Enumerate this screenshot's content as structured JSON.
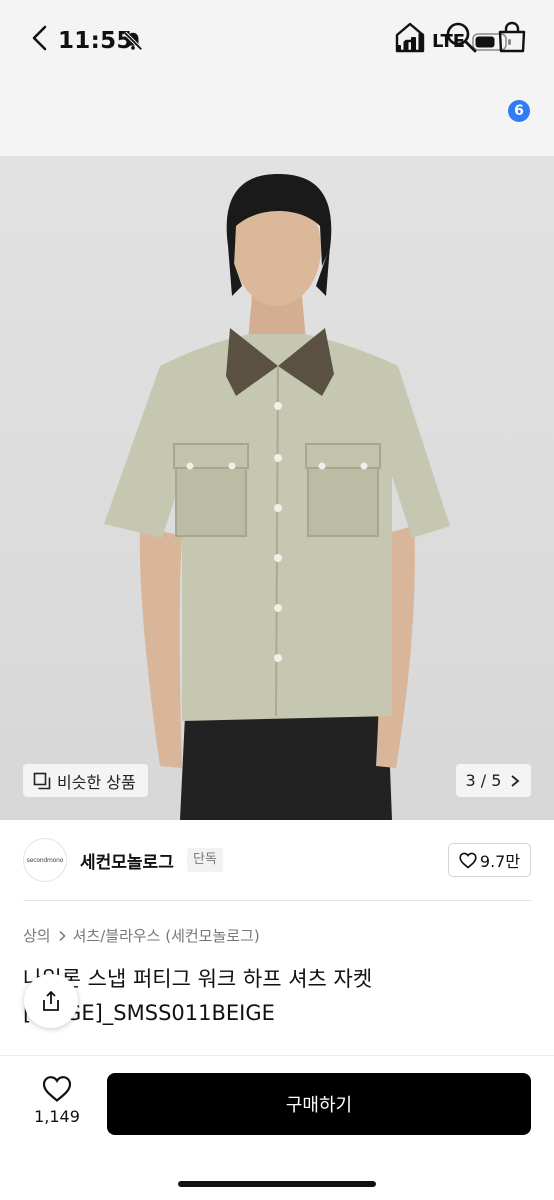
{
  "status_bar": {
    "time": "11:55",
    "network": "LTE",
    "icons": [
      "bell-off-icon",
      "signal-icon",
      "battery-icon"
    ]
  },
  "nav": {
    "icons": [
      "back-icon",
      "home-icon",
      "search-icon",
      "cart-icon"
    ],
    "cart_count": "6"
  },
  "gallery": {
    "similar_label": "비슷한 상품",
    "pager": "3 / 5"
  },
  "brand": {
    "logo_text": "secondmono",
    "name": "세컨모놀로그",
    "badge": "단독",
    "likes": "9.7만"
  },
  "breadcrumb": [
    "상의",
    "셔츠/블라우스 (세컨모놀로그)"
  ],
  "product": {
    "title": "나일론 스냅 퍼티그 워크 하프 셔츠 자켓 [BEIGE]_SMSS011BEIGE"
  },
  "bottom": {
    "wish_count": "1,149",
    "buy_label": "구매하기"
  },
  "colors": {
    "accent": "#2f7cf6",
    "shirt": "#c6c7b0",
    "collar": "#5b5142",
    "background": "#f4f4f4"
  }
}
